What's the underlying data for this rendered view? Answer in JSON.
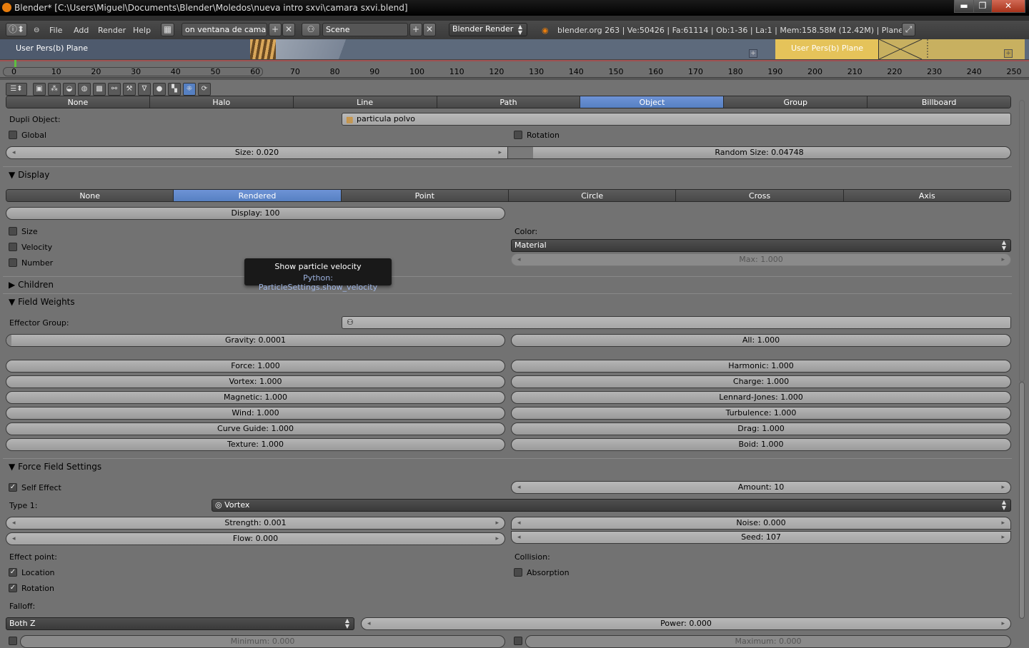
{
  "window": {
    "title": "Blender* [C:\\Users\\Miguel\\Documents\\Blender\\Moledos\\nueva intro sxvi\\camara sxvi.blend]",
    "min_label": "▬",
    "max_label": "❐",
    "close_label": "✕"
  },
  "infobar": {
    "menus": [
      "File",
      "Add",
      "Render",
      "Help"
    ],
    "screen_name": "on ventana de camara",
    "scene_name": "Scene",
    "engine": "Blender Render",
    "stats": "blender.org 263 | Ve:50426 | Fa:61114 | Ob:1-36 | La:1 | Mem:158.58M (12.42M) | Plane"
  },
  "viewport": {
    "left_label": "User Pers(b) Plane",
    "right_label": "User Pers(b) Plane"
  },
  "timeline": {
    "ticks": [
      "0",
      "10",
      "20",
      "30",
      "40",
      "50",
      "60",
      "70",
      "80",
      "90",
      "100",
      "110",
      "120",
      "130",
      "140",
      "150",
      "160",
      "170",
      "180",
      "190",
      "200",
      "210",
      "220",
      "230",
      "240",
      "250"
    ]
  },
  "render_as": {
    "options": [
      "None",
      "Halo",
      "Line",
      "Path",
      "Object",
      "Group",
      "Billboard"
    ],
    "selected": "Object"
  },
  "dupli": {
    "label": "Dupli Object:",
    "value": "particula polvo",
    "global_label": "Global",
    "rotation_label": "Rotation",
    "size": "Size: 0.020",
    "random_size": "Random Size: 0.04748"
  },
  "display": {
    "header": "Display",
    "options": [
      "None",
      "Rendered",
      "Point",
      "Circle",
      "Cross",
      "Axis"
    ],
    "selected": "Rendered",
    "display_amount": "Display: 100",
    "size_label": "Size",
    "velocity_label": "Velocity",
    "number_label": "Number",
    "color_label": "Color:",
    "color_value": "Material",
    "max": "Max: 1.000"
  },
  "tooltip": {
    "title": "Show particle velocity",
    "python": "Python: ParticleSettings.show_velocity"
  },
  "children": {
    "header": "Children"
  },
  "field_weights": {
    "header": "Field Weights",
    "effector_label": "Effector Group:",
    "gravity": "Gravity: 0.0001",
    "all": "All: 1.000",
    "left": [
      "Force: 1.000",
      "Vortex: 1.000",
      "Magnetic: 1.000",
      "Wind: 1.000",
      "Curve Guide: 1.000",
      "Texture: 1.000"
    ],
    "right": [
      "Harmonic: 1.000",
      "Charge: 1.000",
      "Lennard-Jones: 1.000",
      "Turbulence: 1.000",
      "Drag: 1.000",
      "Boid: 1.000"
    ]
  },
  "force_field": {
    "header": "Force Field Settings",
    "self_effect": "Self Effect",
    "amount": "Amount: 10",
    "type_label": "Type 1:",
    "type_value": "Vortex",
    "strength": "Strength: 0.001",
    "noise": "Noise: 0.000",
    "flow": "Flow: 0.000",
    "seed": "Seed: 107",
    "effect_point_label": "Effect point:",
    "location_label": "Location",
    "rotation_label": "Rotation",
    "collision_label": "Collision:",
    "absorption_label": "Absorption",
    "falloff_label": "Falloff:",
    "falloff_value": "Both Z",
    "power": "Power: 0.000",
    "minimum": "Minimum: 0.000",
    "maximum": "Maximum: 0.000"
  }
}
